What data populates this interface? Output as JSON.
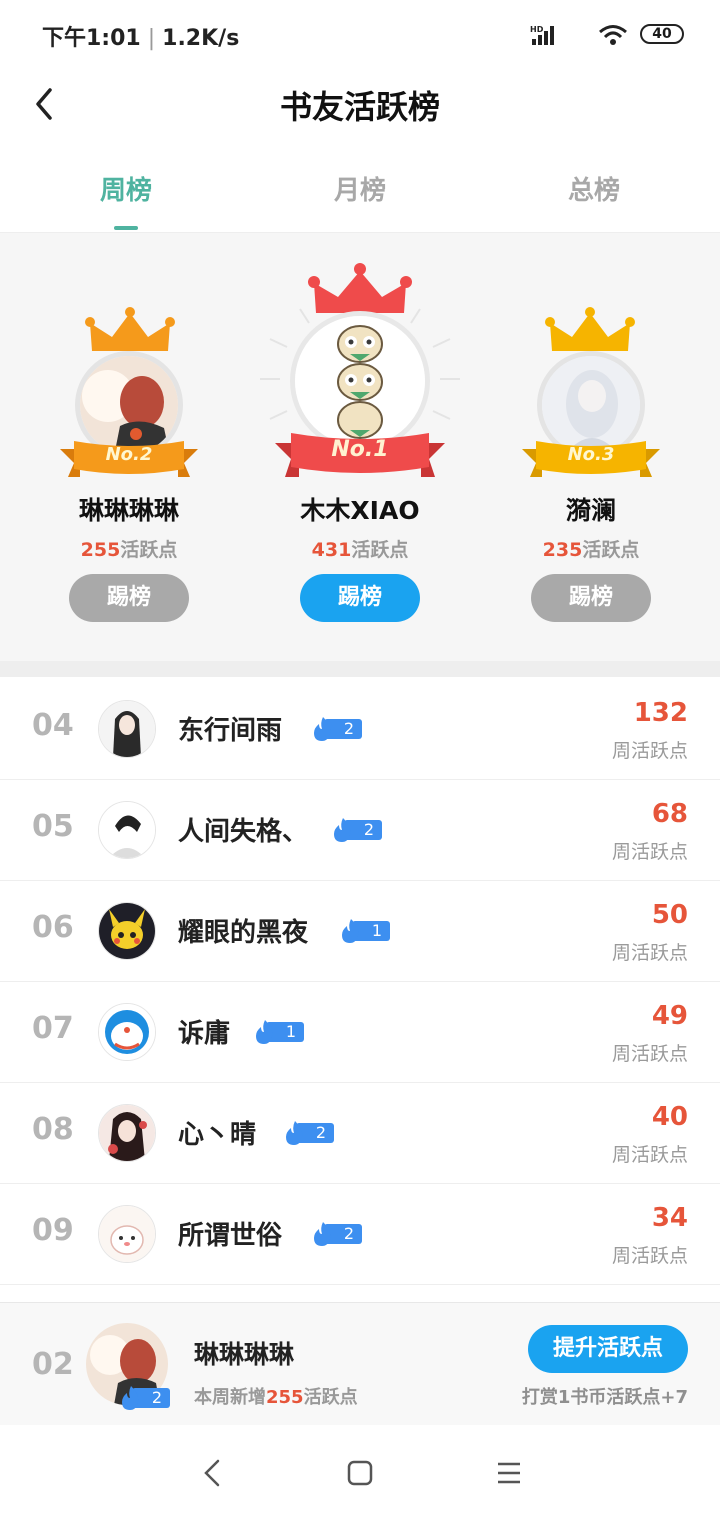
{
  "status": {
    "time": "下午1:01",
    "speed": "1.2K/s",
    "battery": "40",
    "network": "HD"
  },
  "header": {
    "title": "书友活跃榜"
  },
  "tabs": [
    {
      "label": "周榜"
    },
    {
      "label": "月榜"
    },
    {
      "label": "总榜"
    }
  ],
  "podium": {
    "first": {
      "badge": "No.1",
      "name": "木木XIAO",
      "points": "431",
      "points_unit": "活跃点",
      "button": "踢榜"
    },
    "second": {
      "badge": "No.2",
      "name": "琳琳琳琳",
      "points": "255",
      "points_unit": "活跃点",
      "button": "踢榜"
    },
    "third": {
      "badge": "No.3",
      "name": "漪澜",
      "points": "235",
      "points_unit": "活跃点",
      "button": "踢榜"
    }
  },
  "rows": [
    {
      "rank": "04",
      "name": "东行间雨",
      "level": "2",
      "value": "132",
      "label": "周活跃点"
    },
    {
      "rank": "05",
      "name": "人间失格、",
      "level": "2",
      "value": "68",
      "label": "周活跃点"
    },
    {
      "rank": "06",
      "name": "耀眼的黑夜",
      "level": "1",
      "value": "50",
      "label": "周活跃点"
    },
    {
      "rank": "07",
      "name": "诉庸",
      "level": "1",
      "value": "49",
      "label": "周活跃点"
    },
    {
      "rank": "08",
      "name": "心丶晴",
      "level": "2",
      "value": "40",
      "label": "周活跃点"
    },
    {
      "rank": "09",
      "name": "所谓世俗",
      "level": "2",
      "value": "34",
      "label": "周活跃点"
    }
  ],
  "me": {
    "rank": "02",
    "name": "琳琳琳琳",
    "level": "2",
    "sub_prefix": "本周新增",
    "sub_value": "255",
    "sub_suffix": "活跃点",
    "button": "提升活跃点",
    "tip": "打赏1书币活跃点+7"
  },
  "colors": {
    "accent": "#4fb3a0",
    "blue": "#1aa3f0",
    "red": "#e6553a",
    "gold": "#f6b400",
    "orange": "#f59a1b",
    "crown_red": "#ef4b4b"
  }
}
